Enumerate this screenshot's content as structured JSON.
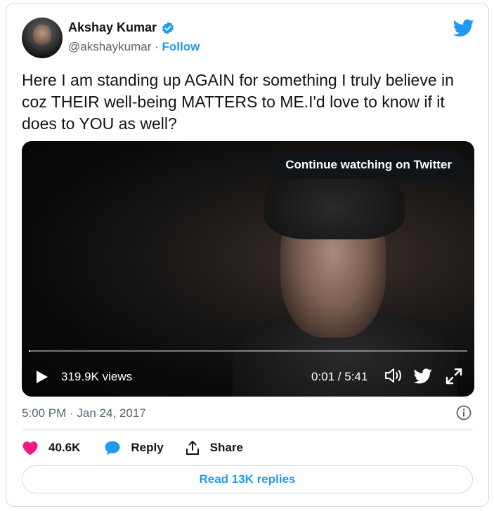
{
  "author": {
    "name": "Akshay Kumar",
    "handle": "@akshaykumar",
    "separator": "·",
    "follow_label": "Follow"
  },
  "tweet": {
    "text": "Here I am standing up AGAIN for something I truly believe in coz THEIR well-being MATTERS to ME.I'd love to know if it does to YOU as well?",
    "timestamp": "5:00 PM · Jan 24, 2017"
  },
  "video": {
    "continue_label": "Continue watching on Twitter",
    "views": "319.9K views",
    "time": "0:01 / 5:41",
    "progress": 0.003
  },
  "actions": {
    "like_count": "40.6K",
    "reply_label": "Reply",
    "share_label": "Share",
    "read_replies_label": "Read 13K replies"
  },
  "colors": {
    "accent": "#1d9bf0",
    "like": "#f91880",
    "text": "#0f1419",
    "secondary": "#536471",
    "border": "#cfd9de"
  },
  "icons": [
    "verified-badge-icon",
    "twitter-bird-icon",
    "play-icon",
    "volume-icon",
    "expand-icon",
    "info-icon",
    "heart-icon",
    "reply-bubble-icon",
    "share-icon"
  ]
}
